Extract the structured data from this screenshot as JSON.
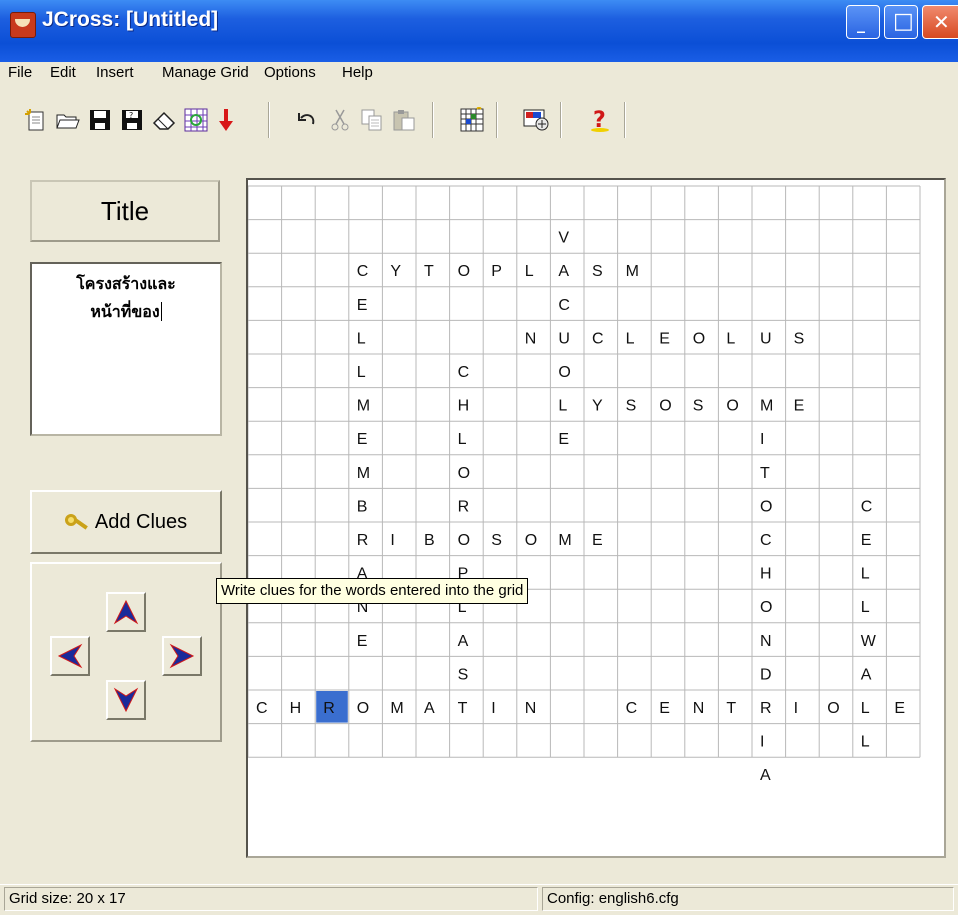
{
  "window": {
    "title": "JCross: [Untitled]",
    "minimize_label": "_",
    "maximize_label": "□",
    "close_label": "✕"
  },
  "menu": {
    "items": [
      {
        "label": "File"
      },
      {
        "label": "Edit"
      },
      {
        "label": "Insert"
      },
      {
        "label": "Manage Grid"
      },
      {
        "label": "Options"
      },
      {
        "label": "Help"
      }
    ]
  },
  "toolbar": {
    "icons": [
      "new-icon",
      "open-icon",
      "save-icon",
      "save-as-icon",
      "eraser-icon",
      "grid-maker-icon",
      "export-icon",
      "undo-icon",
      "cut-icon",
      "copy-icon",
      "paste-icon",
      "grid-icon",
      "web-page-icon",
      "help-icon"
    ]
  },
  "left_panel": {
    "title_button": "Title",
    "title_text_line1": "โครงสร้างและ",
    "title_text_line2": "หน้าที่ของ",
    "add_clues_label": "Add Clues"
  },
  "tooltip": "Write clues for the words entered into the grid",
  "grid": {
    "cols": 20,
    "rows": 17,
    "selected_cell": {
      "row": 15,
      "col": 2
    },
    "selected_color": "#3a6ecf",
    "words": [
      {
        "word": "VACUOLE",
        "row": 1,
        "col": 9,
        "dir": "down"
      },
      {
        "word": "CYTOPLASM",
        "row": 2,
        "col": 3,
        "dir": "across"
      },
      {
        "word": "CELLMEMBRANE",
        "row": 2,
        "col": 3,
        "dir": "down"
      },
      {
        "word": "NUCLEOLUS",
        "row": 4,
        "col": 8,
        "dir": "across"
      },
      {
        "word": "CHLOROPLAS",
        "row": 5,
        "col": 6,
        "dir": "down"
      },
      {
        "word": "LYSOSOME",
        "row": 6,
        "col": 9,
        "dir": "across"
      },
      {
        "word": "MITOCHONDRIA",
        "row": 6,
        "col": 15,
        "dir": "down"
      },
      {
        "word": "RIBOSOME",
        "row": 10,
        "col": 3,
        "dir": "across"
      },
      {
        "word": "CELLWALL",
        "row": 9,
        "col": 18,
        "dir": "down"
      },
      {
        "word": "CHROMATIN",
        "row": 15,
        "col": 0,
        "dir": "across"
      },
      {
        "word": "CENTRIOLE",
        "row": 15,
        "col": 11,
        "dir": "across"
      }
    ]
  },
  "status": {
    "grid_size": "Grid size: 20 x 17",
    "config": "Config: english6.cfg"
  }
}
